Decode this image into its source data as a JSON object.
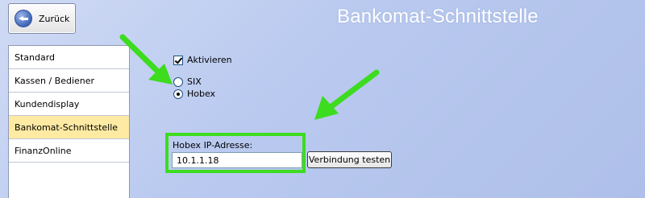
{
  "header": {
    "back_label": "Zurück",
    "title": "Bankomat-Schnittstelle"
  },
  "sidebar": {
    "items": [
      {
        "label": "Standard",
        "active": false
      },
      {
        "label": "Kassen / Bediener",
        "active": false
      },
      {
        "label": "Kundendisplay",
        "active": false
      },
      {
        "label": "Bankomat-Schnittstelle",
        "active": true
      },
      {
        "label": "FinanzOnline",
        "active": false
      }
    ]
  },
  "settings": {
    "activate_label": "Aktivieren",
    "activate_checked": true,
    "provider_options": [
      {
        "label": "SIX",
        "checked": false
      },
      {
        "label": "Hobex",
        "checked": true
      }
    ],
    "ip_label": "Hobex IP-Adresse:",
    "ip_value": "10.1.1.18",
    "test_button_label": "Verbindung testen"
  },
  "colors": {
    "highlight": "#3ddc1f",
    "active_item": "#ffeaa3",
    "title_text": "#ffffff"
  },
  "icons": {
    "back": "arrow-left-circle-icon",
    "annotation": "green-arrow-icon"
  }
}
